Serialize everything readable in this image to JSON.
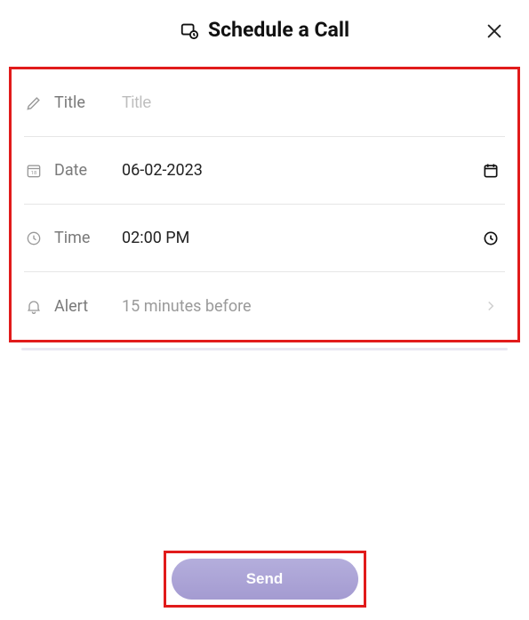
{
  "header": {
    "title": "Schedule a Call"
  },
  "fields": {
    "title": {
      "label": "Title",
      "placeholder": "Title",
      "value": ""
    },
    "date": {
      "label": "Date",
      "value": "06-02-2023"
    },
    "time": {
      "label": "Time",
      "value": "02:00 PM"
    },
    "alert": {
      "label": "Alert",
      "value": "15 minutes before"
    }
  },
  "actions": {
    "send_label": "Send"
  }
}
